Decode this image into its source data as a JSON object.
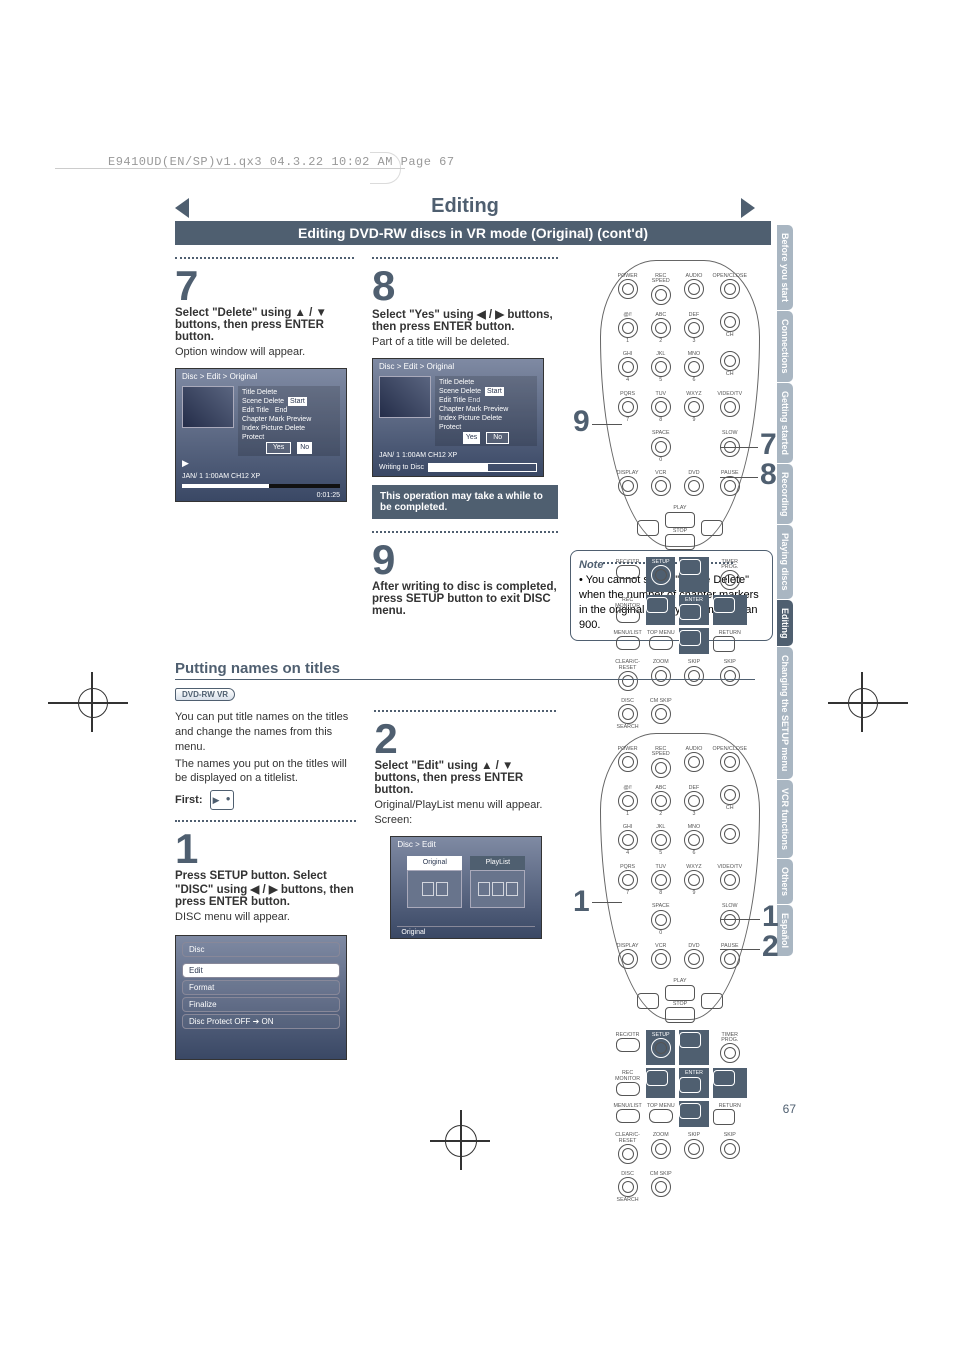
{
  "ruler_text": "E9410UD(EN/SP)v1.qx3  04.3.22  10:02 AM  Page 67",
  "heading1": "Editing",
  "heading2": "Editing DVD-RW discs in VR mode (Original) (cont'd)",
  "tabs": [
    "Before you start",
    "Connections",
    "Getting started",
    "Recording",
    "Playing discs",
    "Editing",
    "Changing the SETUP menu",
    "VCR functions",
    "Others",
    "Español"
  ],
  "tabs_active_index": 5,
  "step7": {
    "num": "7",
    "title": "Select \"Delete\" using ▲ / ▼ buttons, then press ENTER button.",
    "body": "Option window will appear.",
    "osd": {
      "path": "Disc > Edit > Original",
      "list": [
        "Title Delete",
        "Scene Delete",
        "Edit Title",
        "Chapter Mark",
        "Index Picture",
        "Protect"
      ],
      "popup": [
        "Start",
        "End",
        "Preview",
        "Delete"
      ],
      "popup_sel": 0,
      "yes": "Yes",
      "no": "No",
      "yes_sel": false,
      "foot_l": "JAN/ 1   1:00AM  CH12     XP",
      "foot_r": "0:01:25"
    }
  },
  "step8": {
    "num": "8",
    "title": "Select \"Yes\" using ◀ / ▶ buttons, then press ENTER button.",
    "body": "Part of a title will be deleted.",
    "osd": {
      "path": "Disc > Edit > Original",
      "list": [
        "Title Delete",
        "Scene Delete",
        "Edit Title",
        "Chapter Mark",
        "Index Picture",
        "Protect"
      ],
      "popup": [
        "Start",
        "End",
        "Preview",
        "Delete"
      ],
      "popup_sel": 0,
      "yes": "Yes",
      "no": "No",
      "yes_sel": true,
      "foot_l": "JAN/ 1   1:00AM  CH12     XP",
      "writing": "Writing to Disc"
    },
    "warn": "This operation may take a while to be completed."
  },
  "step9": {
    "num": "9",
    "title": "After writing to disc is completed, press SETUP button to exit DISC menu."
  },
  "note": {
    "label": "Note",
    "text": "• You cannot select \"Scene Delete\" when the number of chapter markers in the original or playlist is more than 900."
  },
  "section2": {
    "heading": "Putting names on titles",
    "logo": "DVD-RW  VR",
    "intro1": "You can put title names on the titles and change the names from this menu.",
    "intro2": "The names you put on the titles will be displayed on a titlelist.",
    "first_label": "First:"
  },
  "step1": {
    "num": "1",
    "title": "Press SETUP button. Select \"DISC\" using ◀ / ▶ buttons, then press ENTER button.",
    "body": "DISC menu will appear.",
    "menu": {
      "header": "Disc",
      "items": [
        "Edit",
        "Format",
        "Finalize",
        "Disc Protect OFF ➔ ON"
      ],
      "sel": 0
    }
  },
  "step2": {
    "num": "2",
    "title": "Select \"Edit\" using ▲ / ▼ buttons, then press ENTER button.",
    "body": "Original/PlayList menu will appear. Screen:",
    "osd": {
      "path": "Disc > Edit",
      "tiles": [
        "Original",
        "PlayList"
      ],
      "sel": 0,
      "foot": "Original"
    }
  },
  "remote1_callouts": {
    "left": "9",
    "right_top": "7",
    "right_bot": "8"
  },
  "remote2_callouts": {
    "left": "1",
    "right_top": "1",
    "right_bot": "2"
  },
  "remote_labels": {
    "r1": [
      "POWER",
      "REC SPEED",
      "AUDIO",
      "OPEN/CLOSE"
    ],
    "r2": [
      "@/!",
      "ABC",
      "DEF",
      ""
    ],
    "r2n": [
      "1",
      "2",
      "3",
      "CH"
    ],
    "r3": [
      "GHI",
      "JKL",
      "MNO",
      "▲"
    ],
    "r3n": [
      "4",
      "5",
      "6",
      "CH"
    ],
    "r4": [
      "PQRS",
      "TUV",
      "WXYZ",
      "VIDEO/TV"
    ],
    "r4n": [
      "7",
      "8",
      "9",
      ""
    ],
    "r5": [
      "",
      "SPACE",
      "",
      "SLOW"
    ],
    "r5n": [
      "",
      "0",
      "",
      ""
    ],
    "r6": [
      "DISPLAY",
      "VCR",
      "DVD",
      "PAUSE"
    ],
    "nav": [
      "◀◀",
      "PLAY",
      "▶▶"
    ],
    "stop": "STOP",
    "r7": [
      "REC/OTR",
      "SETUP",
      "",
      "TIMER PROG."
    ],
    "r8": [
      "REC MONITOR",
      "",
      "ENTER",
      ""
    ],
    "r9": [
      "MENU/LIST",
      "TOP MENU",
      "",
      "RETURN"
    ],
    "r10": [
      "CLEAR/C-RESET",
      "ZOOM",
      "SKIP",
      "SKIP"
    ],
    "r11": [
      "DISC",
      "CM SKIP",
      "",
      ""
    ],
    "r11sub": [
      "SEARCH",
      "",
      "",
      ""
    ]
  },
  "page_number": "67"
}
